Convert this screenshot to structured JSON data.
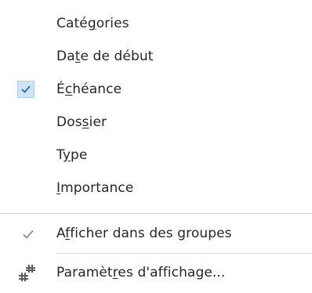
{
  "menu": {
    "items": [
      {
        "pre": "Caté",
        "u": "g",
        "post": "ories"
      },
      {
        "pre": "Da",
        "u": "t",
        "post": "e de début"
      },
      {
        "pre": "É",
        "u": "c",
        "post": "héance"
      },
      {
        "pre": "Dos",
        "u": "s",
        "post": "ier"
      },
      {
        "pre": "T",
        "u": "y",
        "post": "pe"
      },
      {
        "pre": "",
        "u": "I",
        "post": "mportance"
      }
    ],
    "checked_item_index": 2,
    "show_in_groups": {
      "pre": "A",
      "u": "f",
      "post": "ficher dans des groupes",
      "checked": true
    },
    "view_settings": {
      "pre": "Paramèt",
      "u": "r",
      "post": "es d'affichage..."
    }
  },
  "colors": {
    "check_accent": "#2b6cb0",
    "checkbox_bg": "#cfe4f7",
    "separator": "#d6d6d6"
  },
  "icons": {
    "checked_box": "checkbox-checked-icon",
    "checkmark": "checkmark-icon",
    "settings": "view-settings-icon"
  }
}
